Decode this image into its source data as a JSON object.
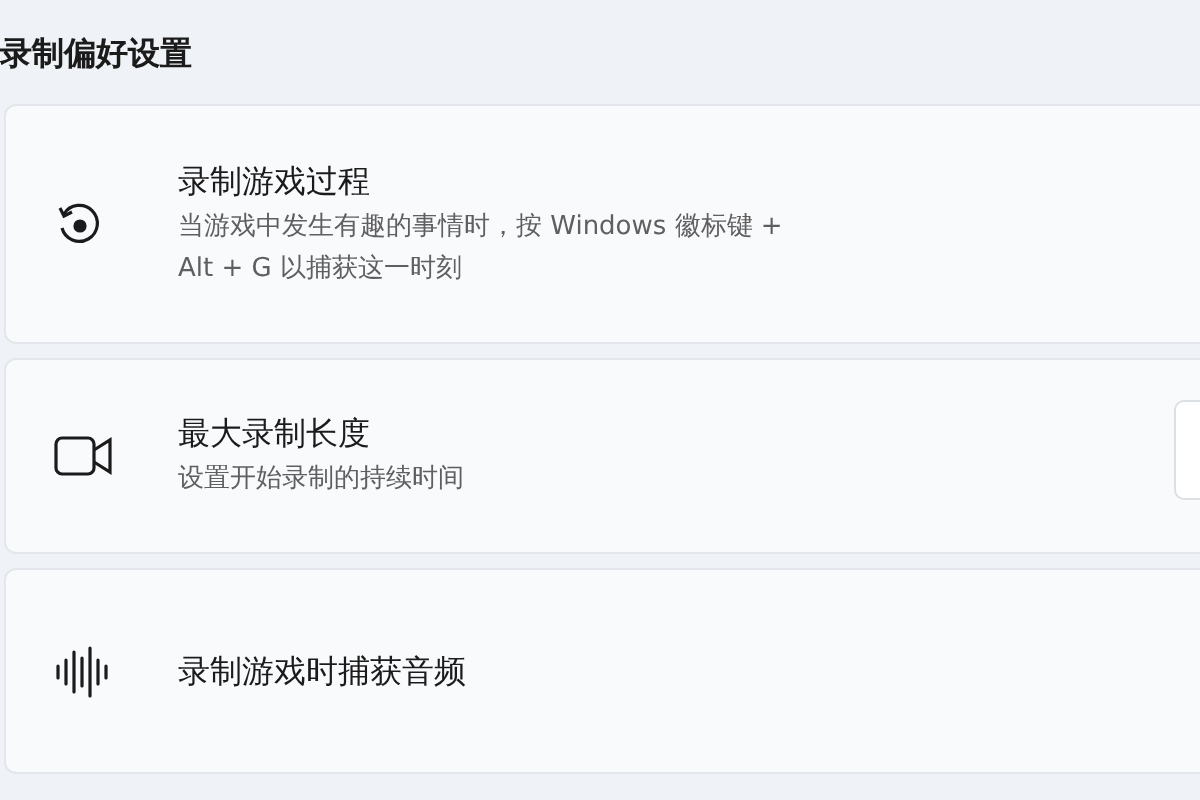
{
  "section_title": "录制偏好设置",
  "settings": [
    {
      "kind": "plain",
      "title": "录制游戏过程",
      "description": "当游戏中发生有趣的事情时，按 Windows 徽标键 +\nAlt + G 以捕获这一时刻"
    },
    {
      "kind": "dropdown",
      "title": "最大录制长度",
      "description": "设置开始录制的持续时间"
    },
    {
      "kind": "plain",
      "title": "录制游戏时捕获音频"
    }
  ]
}
